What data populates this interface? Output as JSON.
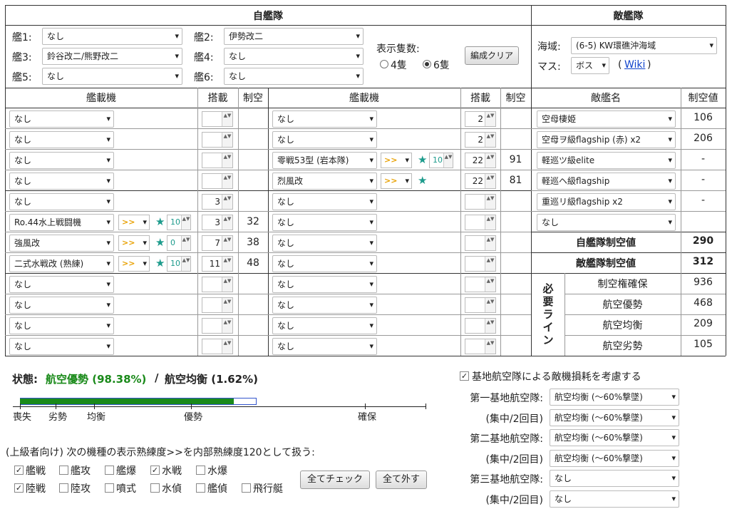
{
  "fleet": {
    "title": "自艦隊",
    "ship_labels": [
      "艦1:",
      "艦2:",
      "艦3:",
      "艦4:",
      "艦5:",
      "艦6:"
    ],
    "ships": [
      "なし",
      "伊勢改二",
      "鈴谷改二/熊野改二",
      "なし",
      "なし",
      "なし"
    ],
    "display_count_label": "表示隻数:",
    "radio_4": "4隻",
    "radio_6": "6隻",
    "radio_selected": "6隻",
    "clear_button": "編成クリア"
  },
  "enemy": {
    "title": "敵艦隊",
    "area_label": "海域:",
    "area_value": "(6-5) KW環礁沖海域",
    "cell_label": "マス:",
    "cell_value": "ボス",
    "wiki_open": "(",
    "wiki_link": "Wiki",
    "wiki_close": ")",
    "col_name": "敵艦名",
    "col_value": "制空値",
    "ships": [
      {
        "name": "空母棲姫",
        "value": "106"
      },
      {
        "name": "空母ヲ級flagship (赤) x2",
        "value": "206"
      },
      {
        "name": "軽巡ツ級elite",
        "value": "-"
      },
      {
        "name": "軽巡ヘ級flagship",
        "value": "-"
      },
      {
        "name": "重巡リ級flagship x2",
        "value": "-"
      },
      {
        "name": "なし",
        "value": ""
      }
    ],
    "own_air_label": "自艦隊制空値",
    "own_air_value": "290",
    "enemy_air_label": "敵艦隊制空値",
    "enemy_air_value": "312",
    "required_label": "必要ライン",
    "required": [
      {
        "label": "制空権確保",
        "value": "936"
      },
      {
        "label": "航空優勢",
        "value": "468"
      },
      {
        "label": "航空均衡",
        "value": "209"
      },
      {
        "label": "航空劣勢",
        "value": "105"
      }
    ]
  },
  "equip_header": {
    "col_plane": "艦載機",
    "col_slot": "搭載",
    "col_air": "制空"
  },
  "left_equip": [
    {
      "name": "なし",
      "slot": "",
      "air": "",
      "prof": "",
      "lv": ""
    },
    {
      "name": "なし",
      "slot": "",
      "air": "",
      "prof": "",
      "lv": ""
    },
    {
      "name": "なし",
      "slot": "",
      "air": "",
      "prof": "",
      "lv": ""
    },
    {
      "name": "なし",
      "slot": "",
      "air": "",
      "prof": "",
      "lv": ""
    },
    {
      "name": "なし",
      "slot": "3",
      "air": "",
      "prof": "",
      "lv": ""
    },
    {
      "name": "Ro.44水上戦闘機",
      "slot": "3",
      "air": "32",
      "prof": ">>",
      "lv": "10"
    },
    {
      "name": "強風改",
      "slot": "7",
      "air": "38",
      "prof": ">>",
      "lv": "0"
    },
    {
      "name": "二式水戦改 (熟練)",
      "slot": "11",
      "air": "48",
      "prof": ">>",
      "lv": "10"
    },
    {
      "name": "なし",
      "slot": "",
      "air": "",
      "prof": "",
      "lv": ""
    },
    {
      "name": "なし",
      "slot": "",
      "air": "",
      "prof": "",
      "lv": ""
    },
    {
      "name": "なし",
      "slot": "",
      "air": "",
      "prof": "",
      "lv": ""
    },
    {
      "name": "なし",
      "slot": "",
      "air": "",
      "prof": "",
      "lv": ""
    }
  ],
  "right_equip": [
    {
      "name": "なし",
      "slot": "2",
      "air": "",
      "prof": "",
      "lv": ""
    },
    {
      "name": "なし",
      "slot": "2",
      "air": "",
      "prof": "",
      "lv": ""
    },
    {
      "name": "零戦53型 (岩本隊)",
      "slot": "22",
      "air": "91",
      "prof": ">>",
      "lv": "10"
    },
    {
      "name": "烈風改",
      "slot": "22",
      "air": "81",
      "prof": ">>",
      "lv": ""
    },
    {
      "name": "なし",
      "slot": "",
      "air": "",
      "prof": "",
      "lv": ""
    },
    {
      "name": "なし",
      "slot": "",
      "air": "",
      "prof": "",
      "lv": ""
    },
    {
      "name": "なし",
      "slot": "",
      "air": "",
      "prof": "",
      "lv": ""
    },
    {
      "name": "なし",
      "slot": "",
      "air": "",
      "prof": "",
      "lv": ""
    },
    {
      "name": "なし",
      "slot": "",
      "air": "",
      "prof": "",
      "lv": ""
    },
    {
      "name": "なし",
      "slot": "",
      "air": "",
      "prof": "",
      "lv": ""
    },
    {
      "name": "なし",
      "slot": "",
      "air": "",
      "prof": "",
      "lv": ""
    },
    {
      "name": "なし",
      "slot": "",
      "air": "",
      "prof": "",
      "lv": ""
    }
  ],
  "status": {
    "label": "状態:",
    "primary": "航空優勢 (98.38%)",
    "separator": "/",
    "secondary": "航空均衡 (1.62%)",
    "primary_fraction": 0.9838,
    "secondary_fraction": 0.0162,
    "primary_color": "#1a8a1a",
    "secondary_color": "#3355cc",
    "scale_labels": [
      "喪失",
      "劣勢",
      "均衡",
      "優勢",
      "確保"
    ]
  },
  "advanced": {
    "label": "(上級者向け) 次の機種の表示熟練度>>を内部熟練度120として扱う:",
    "row1": [
      {
        "label": "艦戦",
        "checked": true
      },
      {
        "label": "艦攻",
        "checked": false
      },
      {
        "label": "艦爆",
        "checked": false
      },
      {
        "label": "水戦",
        "checked": true
      },
      {
        "label": "水爆",
        "checked": false
      }
    ],
    "row2": [
      {
        "label": "陸戦",
        "checked": true
      },
      {
        "label": "陸攻",
        "checked": false
      },
      {
        "label": "噴式",
        "checked": false
      },
      {
        "label": "水偵",
        "checked": false
      },
      {
        "label": "艦偵",
        "checked": false
      },
      {
        "label": "飛行艇",
        "checked": false
      }
    ],
    "check_all": "全てチェック",
    "uncheck_all": "全て外す"
  },
  "base": {
    "consider_label": "基地航空隊による敵機損耗を考慮する",
    "consider_checked": true,
    "rows": [
      {
        "label": "第一基地航空隊:",
        "value": "航空均衡 (～60%撃墜)"
      },
      {
        "label": "(集中/2回目)",
        "value": "航空均衡 (～60%撃墜)"
      },
      {
        "label": "第二基地航空隊:",
        "value": "航空均衡 (～60%撃墜)"
      },
      {
        "label": "(集中/2回目)",
        "value": "航空均衡 (～60%撃墜)"
      },
      {
        "label": "第三基地航空隊:",
        "value": "なし"
      },
      {
        "label": "(集中/2回目)",
        "value": "なし"
      }
    ]
  }
}
